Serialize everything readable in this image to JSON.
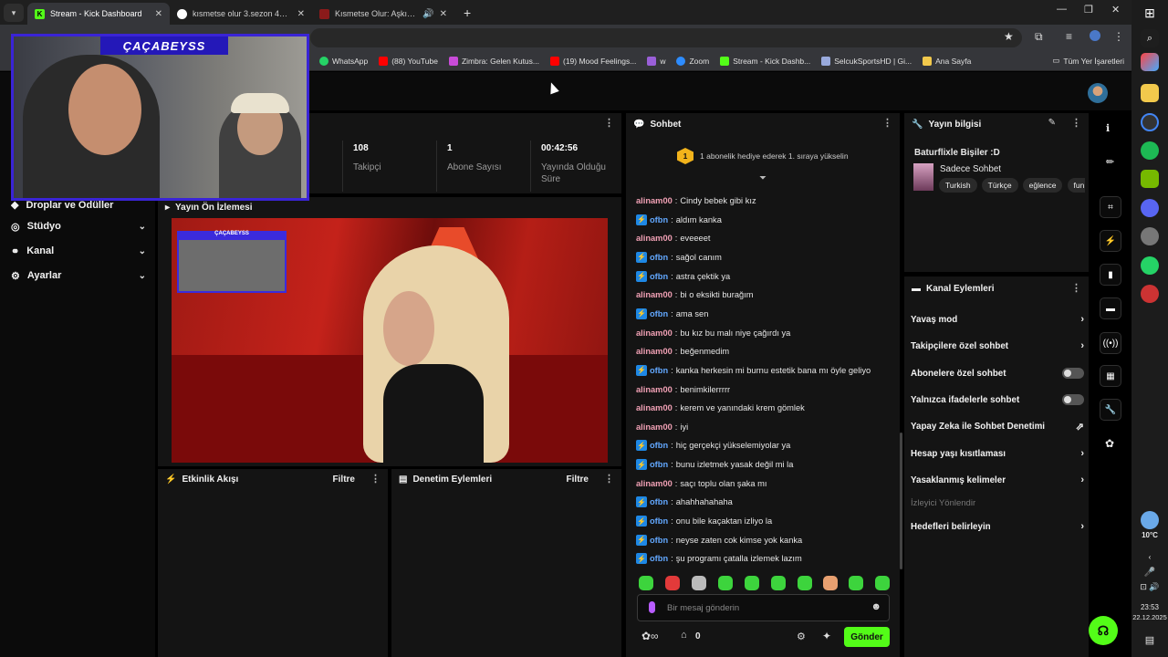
{
  "browser": {
    "tabs": [
      {
        "title": "Stream - Kick Dashboard",
        "active": true
      },
      {
        "title": "kısmetse olur 3.sezon 43.bölüm"
      },
      {
        "title": "Kısmetse Olur: Aşkın Gücü"
      }
    ],
    "bookmarks": [
      "WhatsApp",
      "(88) YouTube",
      "Zimbra: Gelen Kutus...",
      "(19) Mood Feelings...",
      "w",
      "Zoom",
      "Stream - Kick Dashb...",
      "SelcukSportsHD | Gi...",
      "Ana Sayfa"
    ],
    "all_bookmarks": "Tüm Yer İşaretleri"
  },
  "webcam": {
    "streamer_name": "ÇAÇABEYSS"
  },
  "sidebar": {
    "partial_item": "Droplar ve Ödüller",
    "items": [
      {
        "label": "Stüdyo",
        "icon": "studio-icon"
      },
      {
        "label": "Kanal",
        "icon": "channel-icon"
      },
      {
        "label": "Ayarlar",
        "icon": "settings-icon"
      }
    ]
  },
  "stats": [
    {
      "value": "108",
      "label": "Takipçi"
    },
    {
      "value": "1",
      "label": "Abone Sayısı"
    },
    {
      "value": "00:42:56",
      "label": "Yayında Olduğu Süre"
    }
  ],
  "preview": {
    "title": "Yayın Ön İzlemesi"
  },
  "activity": {
    "title": "Etkinlik Akışı",
    "filter": "Filtre"
  },
  "moderation": {
    "title": "Denetim Eylemleri",
    "filter": "Filtre"
  },
  "chat": {
    "title": "Sohbet",
    "pinned_badge": "1",
    "pinned": "1 abonelik hediye ederek 1. sıraya yükselin",
    "messages": [
      {
        "user": "alinam00",
        "text": "Cindy bebek gibi kız",
        "badge": false
      },
      {
        "user": "ofbn",
        "text": "aldım kanka",
        "badge": true
      },
      {
        "user": "alinam00",
        "text": "eveeeet",
        "badge": false
      },
      {
        "user": "ofbn",
        "text": "sağol canım",
        "badge": true
      },
      {
        "user": "ofbn",
        "text": "astra çektik ya",
        "badge": true
      },
      {
        "user": "alinam00",
        "text": "bi o eksikti burağım",
        "badge": false
      },
      {
        "user": "ofbn",
        "text": "ama sen",
        "badge": true
      },
      {
        "user": "alinam00",
        "text": "bu kız bu malı niye çağırdı ya",
        "badge": false
      },
      {
        "user": "alinam00",
        "text": "beğenmedim",
        "badge": false
      },
      {
        "user": "ofbn",
        "text": "kanka herkesin mi burnu estetik bana mı öyle geliyo",
        "badge": true
      },
      {
        "user": "alinam00",
        "text": "benimkilerrrrr",
        "badge": false
      },
      {
        "user": "alinam00",
        "text": "kerem ve yanındaki krem gömlek",
        "badge": false
      },
      {
        "user": "alinam00",
        "text": "iyi",
        "badge": false
      },
      {
        "user": "ofbn",
        "text": "hiç gerçekçi yükselemiyolar ya",
        "badge": true
      },
      {
        "user": "ofbn",
        "text": "bunu izletmek yasak değil mi la",
        "badge": true
      },
      {
        "user": "alinam00",
        "text": "saçı toplu olan şaka mı",
        "badge": false
      },
      {
        "user": "ofbn",
        "text": "ahahhahahaha",
        "badge": true
      },
      {
        "user": "ofbn",
        "text": "onu bile kaçaktan izliyo la",
        "badge": true
      },
      {
        "user": "ofbn",
        "text": "neyse zaten cok kimse yok kanka",
        "badge": true
      },
      {
        "user": "ofbn",
        "text": "şu programı çatalla izlemek lazım",
        "badge": true
      }
    ],
    "input_placeholder": "Bir mesaj gönderin",
    "points": "0",
    "send": "Gönder"
  },
  "stream_info": {
    "title": "Yayın bilgisi",
    "stream_title": "Baturflixle Bişiler :D",
    "category": "Sadece Sohbet",
    "tags": [
      "Turkish",
      "Türkçe",
      "eğlence",
      "funı"
    ]
  },
  "channel_actions": {
    "title": "Kanal Eylemleri",
    "items": [
      {
        "label": "Yavaş mod",
        "control": "arrow"
      },
      {
        "label": "Takipçilere özel sohbet",
        "control": "arrow"
      },
      {
        "label": "Abonelere özel sohbet",
        "control": "toggle"
      },
      {
        "label": "Yalnızca ifadelerle sohbet",
        "control": "toggle"
      },
      {
        "label": "Yapay Zeka ile Sohbet Denetimi",
        "control": "external"
      },
      {
        "label": "Hesap yaşı kısıtlaması",
        "control": "arrow"
      },
      {
        "label": "Yasaklanmış kelimeler",
        "control": "arrow"
      }
    ],
    "section": "İzleyici Yönlendir",
    "goals": "Hedefleri belirleyin"
  },
  "system": {
    "weather": "10°C",
    "time": "23:53",
    "date": "22.12.2025"
  },
  "colors": {
    "kick_green": "#53fc18",
    "sub_user": "#f0a0b4",
    "badge_user": "#62a8ff",
    "webcam_frame": "#3a24d6"
  }
}
